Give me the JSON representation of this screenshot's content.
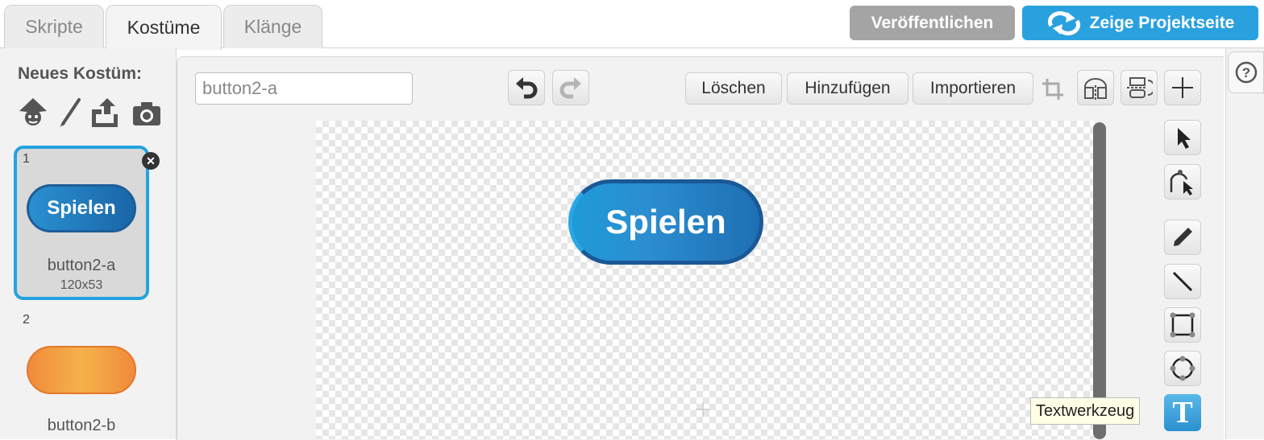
{
  "tabs": [
    {
      "label": "Skripte"
    },
    {
      "label": "Kostüme"
    },
    {
      "label": "Klänge"
    }
  ],
  "top_buttons": {
    "publish": "Veröffentlichen",
    "project_page": "Zeige Projektseite"
  },
  "colors": {
    "accent": "#24a3e0",
    "publish_bg": "#a4a4a4",
    "project_page_bg": "#2aa1df",
    "button_blue": "#2c7fc0",
    "button_orange": "#f2a33c"
  },
  "new_costume": {
    "label": "Neues Kostüm:",
    "icons": [
      "sprite-library-icon",
      "paint-brush-icon",
      "upload-icon",
      "camera-icon"
    ]
  },
  "costumes": [
    {
      "number": "1",
      "name": "button2-a",
      "size": "120x53",
      "thumb_text": "Spielen"
    },
    {
      "number": "2",
      "name": "button2-b"
    }
  ],
  "editor": {
    "costume_name": "button2-a",
    "clear": "Löschen",
    "add": "Hinzufügen",
    "import": "Importieren",
    "canvas_text": "Spielen",
    "tooltip": "Textwerkzeug"
  }
}
